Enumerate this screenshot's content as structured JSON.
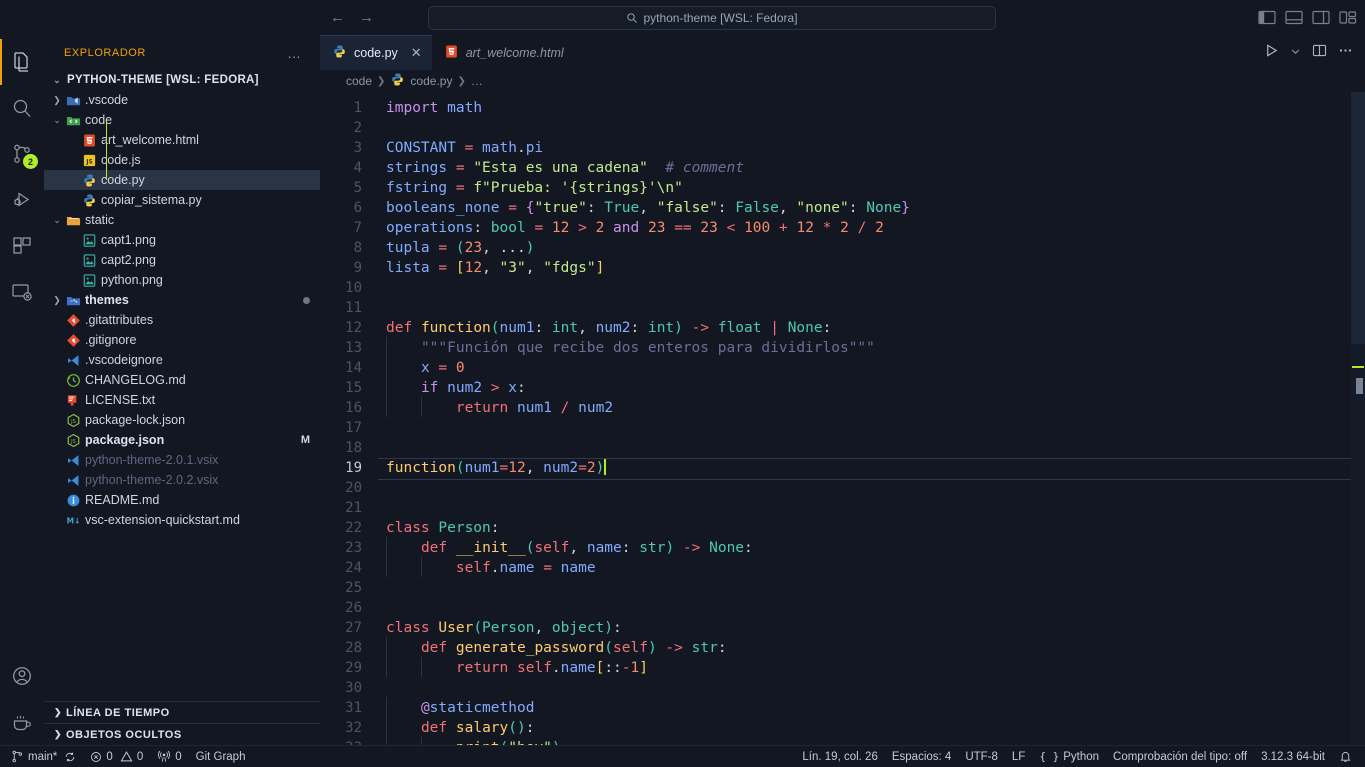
{
  "titlebar": {
    "back_label": "←",
    "forward_label": "→",
    "search_icon": "search-icon",
    "search_text": "python-theme [WSL: Fedora]",
    "layout_icons": [
      "toggle-primary-sidebar-icon",
      "toggle-panel-icon",
      "toggle-secondary-sidebar-icon",
      "customize-layout-icon"
    ]
  },
  "activitybar": {
    "items": [
      {
        "name": "explorer",
        "icon": "files-icon",
        "active": true,
        "badge": ""
      },
      {
        "name": "search",
        "icon": "search-icon",
        "active": false,
        "badge": ""
      },
      {
        "name": "source-control",
        "icon": "source-control-icon",
        "active": false,
        "badge": "2"
      },
      {
        "name": "run-and-debug",
        "icon": "debug-icon",
        "active": false,
        "badge": ""
      },
      {
        "name": "extensions",
        "icon": "extensions-icon",
        "active": false,
        "badge": ""
      },
      {
        "name": "remote-explorer",
        "icon": "remote-explorer-icon",
        "active": false,
        "badge": ""
      }
    ],
    "bottom_items": [
      {
        "name": "accounts",
        "icon": "account-icon"
      },
      {
        "name": "manage",
        "icon": "coffee-icon"
      }
    ]
  },
  "sidebar": {
    "title": "EXPLORADOR",
    "more_actions": "…",
    "root": {
      "label": "PYTHON-THEME [WSL: FEDORA]",
      "expanded": true
    },
    "tree": [
      {
        "label": ".vscode",
        "depth": 1,
        "type": "folder",
        "icon": "folder-vscode-icon",
        "expanded": false
      },
      {
        "label": "code",
        "depth": 1,
        "type": "folder",
        "icon": "folder-code-icon",
        "expanded": true
      },
      {
        "label": "art_welcome.html",
        "depth": 2,
        "type": "file",
        "icon": "html-icon"
      },
      {
        "label": "code.js",
        "depth": 2,
        "type": "file",
        "icon": "js-icon"
      },
      {
        "label": "code.py",
        "depth": 2,
        "type": "file",
        "icon": "python-icon",
        "selected": true
      },
      {
        "label": "copiar_sistema.py",
        "depth": 2,
        "type": "file",
        "icon": "python-icon"
      },
      {
        "label": "static",
        "depth": 1,
        "type": "folder",
        "icon": "folder-static-icon",
        "expanded": true
      },
      {
        "label": "capt1.png",
        "depth": 2,
        "type": "file",
        "icon": "image-icon"
      },
      {
        "label": "capt2.png",
        "depth": 2,
        "type": "file",
        "icon": "image-icon"
      },
      {
        "label": "python.png",
        "depth": 2,
        "type": "file",
        "icon": "image-icon"
      },
      {
        "label": "themes",
        "depth": 1,
        "type": "folder",
        "icon": "folder-themes-icon",
        "expanded": false,
        "bold": true,
        "dot": true
      },
      {
        "label": ".gitattributes",
        "depth": 1,
        "type": "file",
        "icon": "git-icon"
      },
      {
        "label": ".gitignore",
        "depth": 1,
        "type": "file",
        "icon": "git-icon"
      },
      {
        "label": ".vscodeignore",
        "depth": 1,
        "type": "file",
        "icon": "vscode-icon"
      },
      {
        "label": "CHANGELOG.md",
        "depth": 1,
        "type": "file",
        "icon": "changelog-icon"
      },
      {
        "label": "LICENSE.txt",
        "depth": 1,
        "type": "file",
        "icon": "license-icon"
      },
      {
        "label": "package-lock.json",
        "depth": 1,
        "type": "file",
        "icon": "npm-icon"
      },
      {
        "label": "package.json",
        "depth": 1,
        "type": "file",
        "icon": "npm-icon",
        "bold": true,
        "mark": "M"
      },
      {
        "label": "python-theme-2.0.1.vsix",
        "depth": 1,
        "type": "file",
        "icon": "vscode-icon",
        "dim": true
      },
      {
        "label": "python-theme-2.0.2.vsix",
        "depth": 1,
        "type": "file",
        "icon": "vscode-icon",
        "dim": true
      },
      {
        "label": "README.md",
        "depth": 1,
        "type": "file",
        "icon": "readme-icon"
      },
      {
        "label": "vsc-extension-quickstart.md",
        "depth": 1,
        "type": "file",
        "icon": "markdown-icon"
      }
    ],
    "panels": [
      {
        "label": "LÍNEA DE TIEMPO",
        "expanded": false
      },
      {
        "label": "OBJETOS OCULTOS",
        "expanded": false
      }
    ]
  },
  "editor": {
    "tabs": [
      {
        "label": "code.py",
        "icon": "python-icon",
        "active": true,
        "italic": false,
        "close": "✕"
      },
      {
        "label": "art_welcome.html",
        "icon": "html-icon",
        "active": false,
        "italic": true,
        "close": ""
      }
    ],
    "actions": [
      "run-python-file-icon",
      "run-dropdown-icon",
      "split-editor-icon",
      "more-actions-icon"
    ],
    "breadcrumb": [
      "code",
      "code.py",
      "…"
    ],
    "breadcrumb_icon": "python-icon",
    "cursor_line": 19,
    "first_line": 1,
    "last_line": 33,
    "lines": [
      "import math",
      "",
      "CONSTANT = math.pi",
      "strings = \"Esta es una cadena\"  # comment",
      "fstring = f\"Prueba: '{strings}'\\n\"",
      "booleans_none = {\"true\": True, \"false\": False, \"none\": None}",
      "operations: bool = 12 > 2 and 23 == 23 < 100 + 12 * 2 / 2",
      "tupla = (23, ...)",
      "lista = [12, \"3\", \"fdgs\"]",
      "",
      "",
      "def function(num1: int, num2: int) -> float | None:",
      "    \"\"\"Función que recibe dos enteros para dividirlos\"\"\"",
      "    x = 0",
      "    if num2 > x:",
      "        return num1 / num2",
      "",
      "",
      "function(num1=12, num2=2)",
      "",
      "",
      "class Person:",
      "    def __init__(self, name: str) -> None:",
      "        self.name = name",
      "",
      "",
      "class User(Person, object):",
      "    def generate_password(self) -> str:",
      "        return self.name[::-1]",
      "",
      "    @staticmethod",
      "    def salary():",
      "        print(\"hey\")"
    ]
  },
  "statusbar": {
    "left": [
      {
        "name": "remote-branch",
        "icon": "branch-icon",
        "text": "main*",
        "extra_icon": "sync-icon"
      },
      {
        "name": "problems",
        "icon": "error-icon",
        "text": "0",
        "icon2": "warning-icon",
        "text2": "0"
      },
      {
        "name": "ports",
        "icon": "radio-tower-icon",
        "text": "0"
      },
      {
        "name": "git-graph",
        "icon": "",
        "text": "Git Graph"
      }
    ],
    "right": [
      {
        "name": "cursor-position",
        "text": "Lín. 19, col. 26"
      },
      {
        "name": "indentation",
        "text": "Espacios: 4"
      },
      {
        "name": "encoding",
        "text": "UTF-8"
      },
      {
        "name": "eol",
        "text": "LF"
      },
      {
        "name": "language-mode",
        "text": "Python",
        "icon": "braces-icon"
      },
      {
        "name": "type-checking",
        "text": "Comprobación del tipo: off"
      },
      {
        "name": "python-version",
        "text": "3.12.3 64-bit"
      },
      {
        "name": "notifications",
        "text": "",
        "icon": "bell-icon"
      }
    ]
  },
  "colors": {
    "background": "#121721",
    "editor_background": "#121721",
    "accent": "#f0a202",
    "badge": "#b3ec27",
    "selection": "#2a3447",
    "string": "#c3e88d",
    "keyword": "#c792ea",
    "function": "#82aaff",
    "number": "#f78c6c",
    "comment": "#697098",
    "class": "#ffcb6b",
    "type": "#4ec9b0"
  }
}
